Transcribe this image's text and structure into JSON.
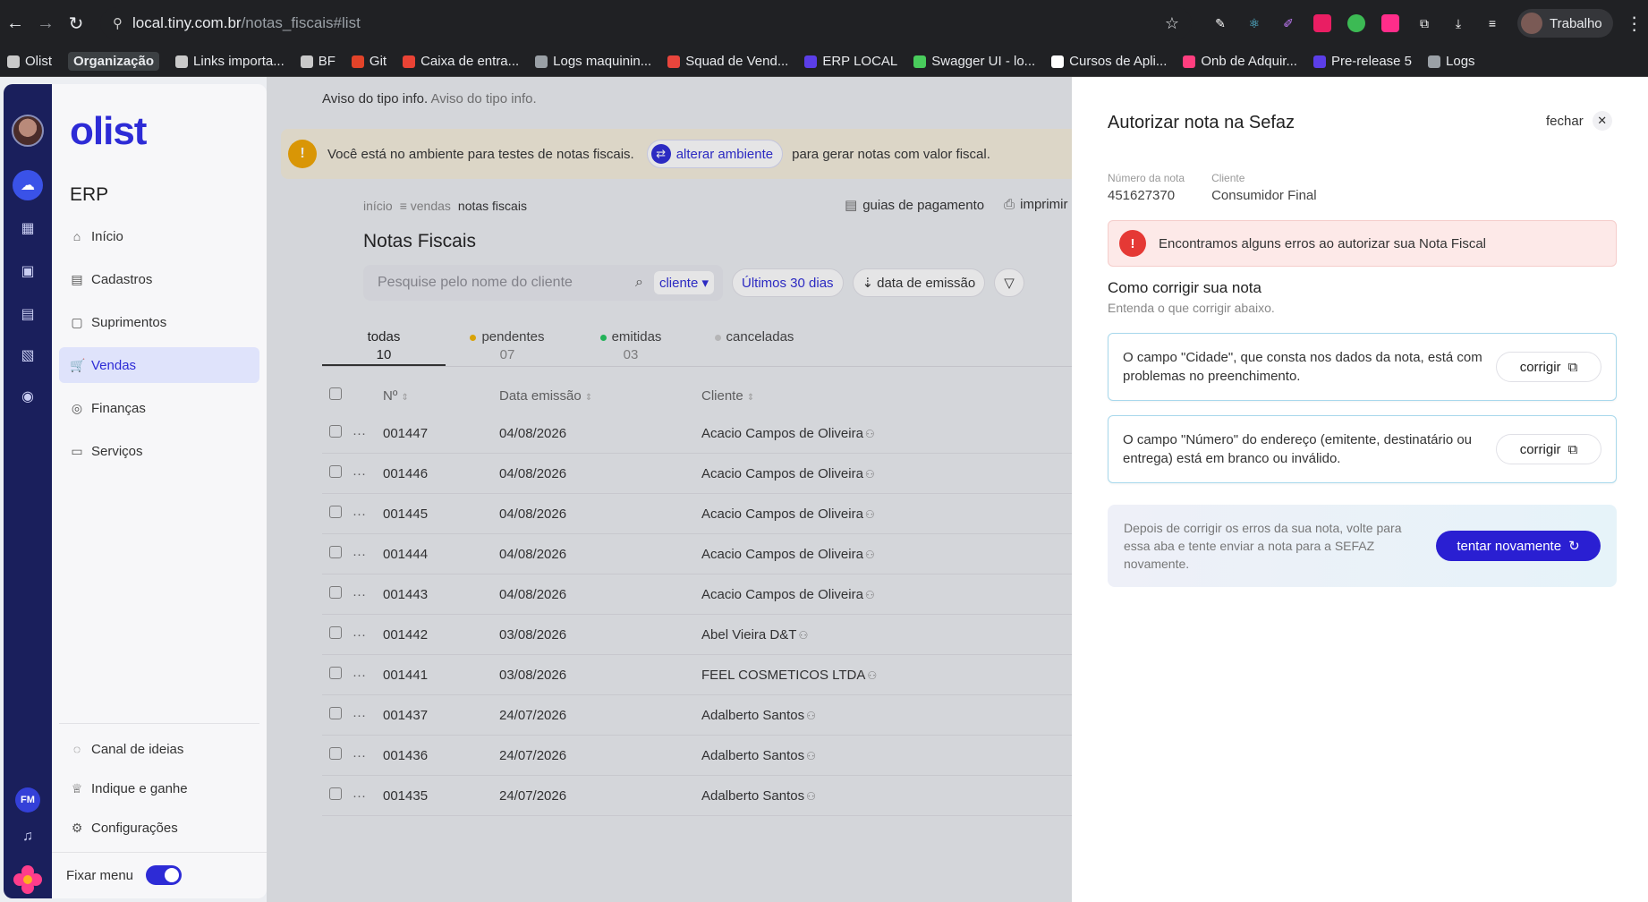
{
  "browser": {
    "url_host": "local.tiny.com.br",
    "url_path": "/notas_fiscais#list",
    "profile_label": "Trabalho",
    "bookmarks": [
      {
        "label": "Olist",
        "color": "#c9c9c9"
      },
      {
        "label": "Organização",
        "color": ""
      },
      {
        "label": "Links importa...",
        "color": "#c9c9c9"
      },
      {
        "label": "BF",
        "color": "#c9c9c9"
      },
      {
        "label": "Git",
        "color": "#e24329"
      },
      {
        "label": "Caixa de entra...",
        "color": "#ea4335"
      },
      {
        "label": "Logs maquinin...",
        "color": "#9aa0a6"
      },
      {
        "label": "Squad de Vend...",
        "color": "#e8453c"
      },
      {
        "label": "ERP LOCAL",
        "color": "#5b3ee8"
      },
      {
        "label": "Swagger UI - lo...",
        "color": "#49cc5c"
      },
      {
        "label": "Cursos de Apli...",
        "color": "#ffffff"
      },
      {
        "label": "Onb de Adquir...",
        "color": "#ff3e7f"
      },
      {
        "label": "Pre-release 5",
        "color": "#5b3ee8"
      },
      {
        "label": "Logs",
        "color": "#9aa0a6"
      }
    ]
  },
  "sidebar": {
    "logo": "olist",
    "section": "ERP",
    "items": [
      {
        "label": "Início",
        "icon": "home-icon",
        "glyph": "⌂"
      },
      {
        "label": "Cadastros",
        "icon": "cadastros-icon",
        "glyph": "▤"
      },
      {
        "label": "Suprimentos",
        "icon": "box-icon",
        "glyph": "▢"
      },
      {
        "label": "Vendas",
        "icon": "cart-icon",
        "glyph": "🛒"
      },
      {
        "label": "Finanças",
        "icon": "coin-icon",
        "glyph": "◎"
      },
      {
        "label": "Serviços",
        "icon": "briefcase-icon",
        "glyph": "▭"
      }
    ],
    "bottom_items": [
      {
        "label": "Canal de ideias",
        "icon": "lightbulb-icon",
        "glyph": "◌"
      },
      {
        "label": "Indique e ganhe",
        "icon": "trophy-icon",
        "glyph": "♕"
      },
      {
        "label": "Configurações",
        "icon": "gear-icon",
        "glyph": "⚙"
      }
    ],
    "fix_menu_label": "Fixar menu",
    "rail_initials": "FM"
  },
  "main": {
    "info_bold": "Aviso do tipo info.",
    "info_muted": "Aviso do tipo info.",
    "env_warning_pre": "Você está no ambiente para testes de notas fiscais.",
    "env_button": "alterar ambiente",
    "env_warning_post": "para gerar notas com valor fiscal.",
    "crumbs": [
      "início",
      "vendas",
      "notas fiscais"
    ],
    "actions": [
      "guias de pagamento",
      "imprimir"
    ],
    "title": "Notas Fiscais",
    "search_placeholder": "Pesquise pelo nome do cliente",
    "search_scope": "cliente",
    "filter_period": "Últimos 30 dias",
    "filter_sort": "data de emissão",
    "tabs": [
      {
        "label": "todas",
        "count": "10",
        "dot": ""
      },
      {
        "label": "pendentes",
        "count": "07",
        "dot": "#f2b400"
      },
      {
        "label": "emitidas",
        "count": "03",
        "dot": "#22c55e"
      },
      {
        "label": "canceladas",
        "count": "",
        "dot": "#c9c9c9"
      }
    ],
    "columns": [
      "Nº",
      "Data emissão",
      "Cliente"
    ],
    "rows": [
      {
        "num": "001447",
        "date": "04/08/2026",
        "client": "Acacio Campos de Oliveira"
      },
      {
        "num": "001446",
        "date": "04/08/2026",
        "client": "Acacio Campos de Oliveira"
      },
      {
        "num": "001445",
        "date": "04/08/2026",
        "client": "Acacio Campos de Oliveira"
      },
      {
        "num": "001444",
        "date": "04/08/2026",
        "client": "Acacio Campos de Oliveira"
      },
      {
        "num": "001443",
        "date": "04/08/2026",
        "client": "Acacio Campos de Oliveira"
      },
      {
        "num": "001442",
        "date": "03/08/2026",
        "client": "Abel Vieira D&T"
      },
      {
        "num": "001441",
        "date": "03/08/2026",
        "client": "FEEL COSMETICOS LTDA"
      },
      {
        "num": "001437",
        "date": "24/07/2026",
        "client": "Adalberto Santos"
      },
      {
        "num": "001436",
        "date": "24/07/2026",
        "client": "Adalberto Santos"
      },
      {
        "num": "001435",
        "date": "24/07/2026",
        "client": "Adalberto Santos"
      }
    ]
  },
  "drawer": {
    "title": "Autorizar nota na Sefaz",
    "close_label": "fechar",
    "number_label": "Número da nota",
    "number_value": "451627370",
    "client_label": "Cliente",
    "client_value": "Consumidor Final",
    "error_message": "Encontramos alguns erros ao autorizar sua Nota Fiscal",
    "howto_title": "Como corrigir sua nota",
    "howto_subtitle": "Entenda o que corrigir abaixo.",
    "fixes": [
      {
        "text": "O campo \"Cidade\", que consta nos dados da nota, está com problemas no preenchimento.",
        "button": "corrigir"
      },
      {
        "text": "O campo \"Número\" do endereço (emitente, destinatário ou entrega) está em branco ou inválido.",
        "button": "corrigir"
      }
    ],
    "retry_text": "Depois de corrigir os erros da sua nota, volte para essa aba e tente enviar a nota para a SEFAZ novamente.",
    "retry_button": "tentar novamente"
  }
}
